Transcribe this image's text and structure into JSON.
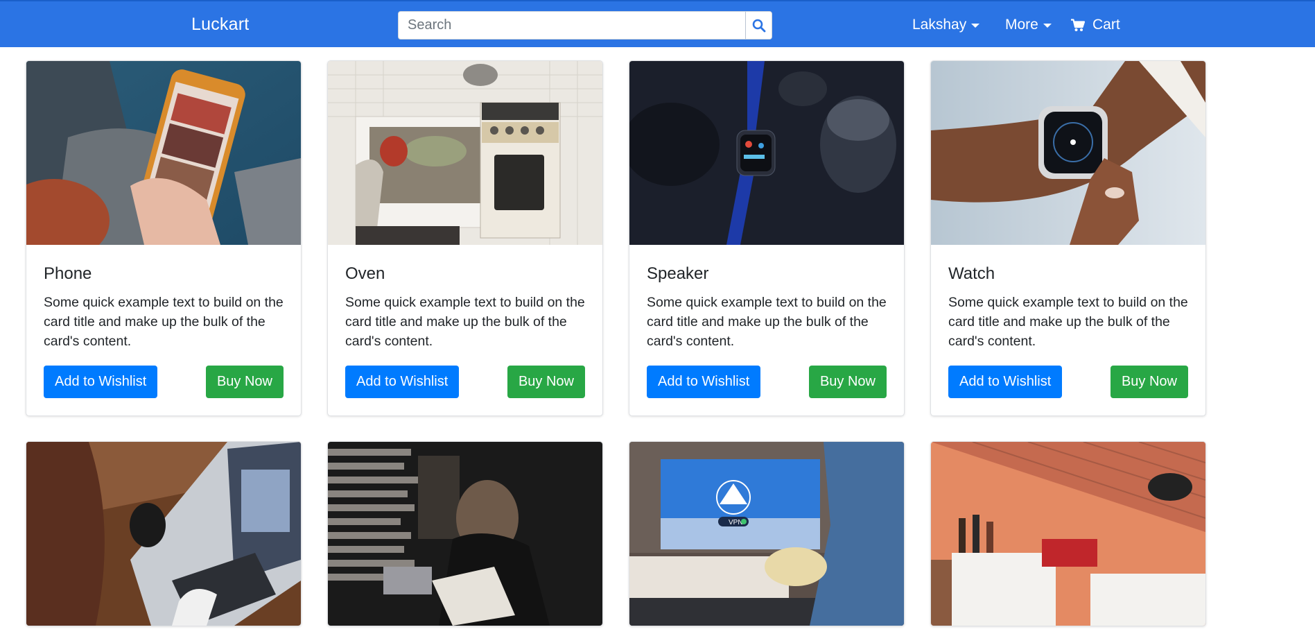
{
  "navbar": {
    "brand": "Luckart",
    "search_placeholder": "Search",
    "user_menu": "Lakshay",
    "more_menu": "More",
    "cart": "Cart",
    "color": "#2b74e4"
  },
  "products": [
    {
      "title": "Phone",
      "text": "Some quick example text to build on the card title and make up the bulk of the card's content.",
      "wishlist_label": "Add to Wishlist",
      "buy_label": "Buy Now",
      "image": "phone-photo"
    },
    {
      "title": "Oven",
      "text": "Some quick example text to build on the card title and make up the bulk of the card's content.",
      "wishlist_label": "Add to Wishlist",
      "buy_label": "Buy Now",
      "image": "oven-photo"
    },
    {
      "title": "Speaker",
      "text": "Some quick example text to build on the card title and make up the bulk of the card's content.",
      "wishlist_label": "Add to Wishlist",
      "buy_label": "Buy Now",
      "image": "speaker-photo"
    },
    {
      "title": "Watch",
      "text": "Some quick example text to build on the card title and make up the bulk of the card's content.",
      "wishlist_label": "Add to Wishlist",
      "buy_label": "Buy Now",
      "image": "watch-photo"
    },
    {
      "image": "laptop-photo"
    },
    {
      "image": "books-photo"
    },
    {
      "image": "tv-photo",
      "image_text": "VPN"
    },
    {
      "image": "kitchen-photo"
    }
  ],
  "colors": {
    "wishlist_button": "#007bff",
    "buy_button": "#28a745"
  }
}
